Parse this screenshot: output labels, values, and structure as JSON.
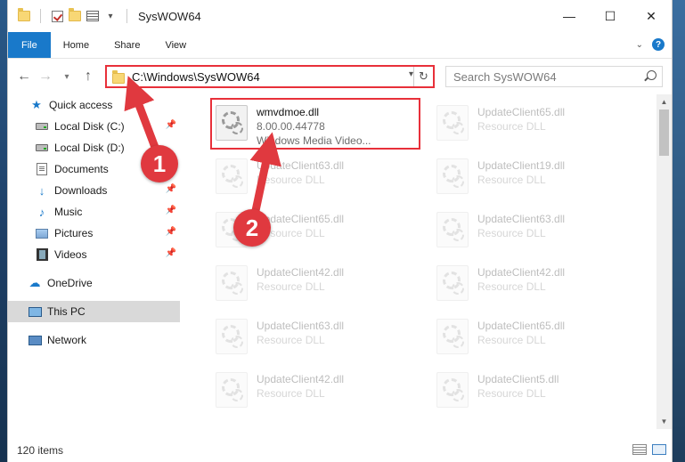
{
  "window": {
    "title": "SysWOW64",
    "controls": {
      "minimize": "—",
      "maximize": "☐",
      "close": "✕"
    }
  },
  "ribbon": {
    "tabs": [
      "File",
      "Home",
      "Share",
      "View"
    ]
  },
  "address": {
    "path": "C:\\Windows\\SysWOW64",
    "search_placeholder": "Search SysWOW64"
  },
  "sidebar": {
    "items": [
      {
        "label": "Quick access",
        "icon": "star-icon",
        "pinned": false
      },
      {
        "label": "Local Disk (C:)",
        "icon": "drive-icon",
        "pinned": true
      },
      {
        "label": "Local Disk (D:)",
        "icon": "drive-icon",
        "pinned": false
      },
      {
        "label": "Documents",
        "icon": "documents-icon",
        "pinned": false
      },
      {
        "label": "Downloads",
        "icon": "downloads-icon",
        "pinned": true
      },
      {
        "label": "Music",
        "icon": "music-icon",
        "pinned": true
      },
      {
        "label": "Pictures",
        "icon": "pictures-icon",
        "pinned": true
      },
      {
        "label": "Videos",
        "icon": "videos-icon",
        "pinned": true
      },
      {
        "label": "OneDrive",
        "icon": "onedrive-icon",
        "pinned": false
      },
      {
        "label": "This PC",
        "icon": "this-pc-icon",
        "pinned": false,
        "selected": true
      },
      {
        "label": "Network",
        "icon": "network-icon",
        "pinned": false
      }
    ]
  },
  "files": [
    {
      "name": "wmvdmoe.dll",
      "line2": "8.00.00.44778",
      "line3": "Windows Media Video...",
      "highlighted": true
    },
    {
      "name": "UpdateClient65.dll",
      "line2": "Resource DLL"
    },
    {
      "name": "UpdateClient63.dll",
      "line2": "Resource DLL"
    },
    {
      "name": "UpdateClient19.dll",
      "line2": "Resource DLL"
    },
    {
      "name": "UpdateClient65.dll",
      "line2": "Resource DLL"
    },
    {
      "name": "UpdateClient63.dll",
      "line2": "Resource DLL"
    },
    {
      "name": "UpdateClient42.dll",
      "line2": "Resource DLL"
    },
    {
      "name": "UpdateClient42.dll",
      "line2": "Resource DLL"
    },
    {
      "name": "UpdateClient63.dll",
      "line2": "Resource DLL"
    },
    {
      "name": "UpdateClient65.dll",
      "line2": "Resource DLL"
    },
    {
      "name": "UpdateClient42.dll",
      "line2": "Resource DLL"
    },
    {
      "name": "UpdateClient5.dll",
      "line2": "Resource DLL"
    }
  ],
  "status": {
    "item_count": "120 items"
  },
  "annotations": {
    "step1": "1",
    "step2": "2",
    "color": "#e0393f"
  }
}
